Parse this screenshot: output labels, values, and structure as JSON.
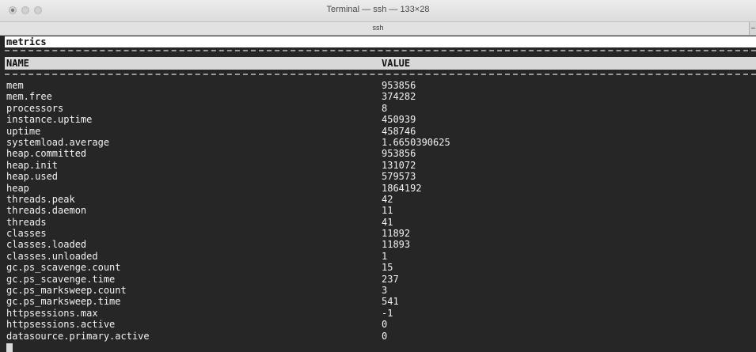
{
  "window": {
    "title": "Terminal — ssh — 133×28",
    "tab_label": "ssh"
  },
  "terminal": {
    "section_title": "metrics",
    "columns": {
      "name": "NAME",
      "value": "VALUE"
    },
    "rows": [
      {
        "name": "mem",
        "value": "953856"
      },
      {
        "name": "mem.free",
        "value": "374282"
      },
      {
        "name": "processors",
        "value": "8"
      },
      {
        "name": "instance.uptime",
        "value": "450939"
      },
      {
        "name": "uptime",
        "value": "458746"
      },
      {
        "name": "systemload.average",
        "value": "1.6650390625"
      },
      {
        "name": "heap.committed",
        "value": "953856"
      },
      {
        "name": "heap.init",
        "value": "131072"
      },
      {
        "name": "heap.used",
        "value": "579573"
      },
      {
        "name": "heap",
        "value": "1864192"
      },
      {
        "name": "threads.peak",
        "value": "42"
      },
      {
        "name": "threads.daemon",
        "value": "11"
      },
      {
        "name": "threads",
        "value": "41"
      },
      {
        "name": "classes",
        "value": "11892"
      },
      {
        "name": "classes.loaded",
        "value": "11893"
      },
      {
        "name": "classes.unloaded",
        "value": "1"
      },
      {
        "name": "gc.ps_scavenge.count",
        "value": "15"
      },
      {
        "name": "gc.ps_scavenge.time",
        "value": "237"
      },
      {
        "name": "gc.ps_marksweep.count",
        "value": "3"
      },
      {
        "name": "gc.ps_marksweep.time",
        "value": "541"
      },
      {
        "name": "httpsessions.max",
        "value": "-1"
      },
      {
        "name": "httpsessions.active",
        "value": "0"
      },
      {
        "name": "datasource.primary.active",
        "value": "0"
      }
    ]
  },
  "colors": {
    "terminal_bg": "#262626",
    "text": "#f2f2f2",
    "header_bg": "#ffffff",
    "column_header_bg": "#d8d8d8"
  }
}
